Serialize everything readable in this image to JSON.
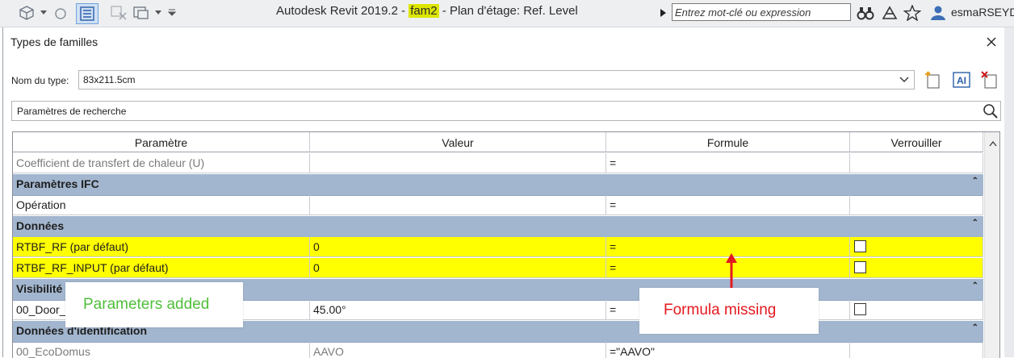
{
  "titlebar": {
    "app_name": "Autodesk Revit 2019.2 - ",
    "file_name": "fam2",
    "view_name": " - Plan d'étage: Ref. Level",
    "search_placeholder": "Entrez mot-clé ou expression",
    "user": "esmaRSEYD"
  },
  "dialog": {
    "title": "Types de familles",
    "type_label": "Nom du type:",
    "type_value": "83x211.5cm",
    "search_placeholder": "Paramètres de recherche"
  },
  "grid": {
    "headers": [
      "Paramètre",
      "Valeur",
      "Formule",
      "Verrouiller"
    ],
    "rows": [
      {
        "kind": "param",
        "name": "Coefficient de transfert de chaleur (U)",
        "value": "",
        "formula": "=",
        "lock": false,
        "greyed": true
      },
      {
        "kind": "group",
        "name": "Paramètres IFC"
      },
      {
        "kind": "param",
        "name": "Opération",
        "value": "",
        "formula": "=",
        "lock": false
      },
      {
        "kind": "group",
        "name": "Données"
      },
      {
        "kind": "param",
        "name": "RTBF_RF (par défaut)",
        "value": "0",
        "formula": "=",
        "lock": true,
        "highlight": true
      },
      {
        "kind": "param",
        "name": "RTBF_RF_INPUT (par défaut)",
        "value": "0",
        "formula": "=",
        "lock": true,
        "highlight": true
      },
      {
        "kind": "group",
        "name": "Visibilité"
      },
      {
        "kind": "param",
        "name": "00_Door_",
        "value": "45.00°",
        "formula": "=",
        "lock": true
      },
      {
        "kind": "group",
        "name": "Données d'identification"
      },
      {
        "kind": "param",
        "name": "00_EcoDomus",
        "value": "AAVO",
        "formula": "=\"AAVO\"",
        "lock": false,
        "greyed": true
      }
    ]
  },
  "annotations": {
    "added": "Parameters added",
    "missing": "Formula missing",
    "added_color": "#4fbf3a",
    "missing_color": "#e3191f"
  },
  "colors": {
    "group_band": "#a3b6cf",
    "highlight": "#ffff00",
    "title_highlight": "#dde600"
  }
}
